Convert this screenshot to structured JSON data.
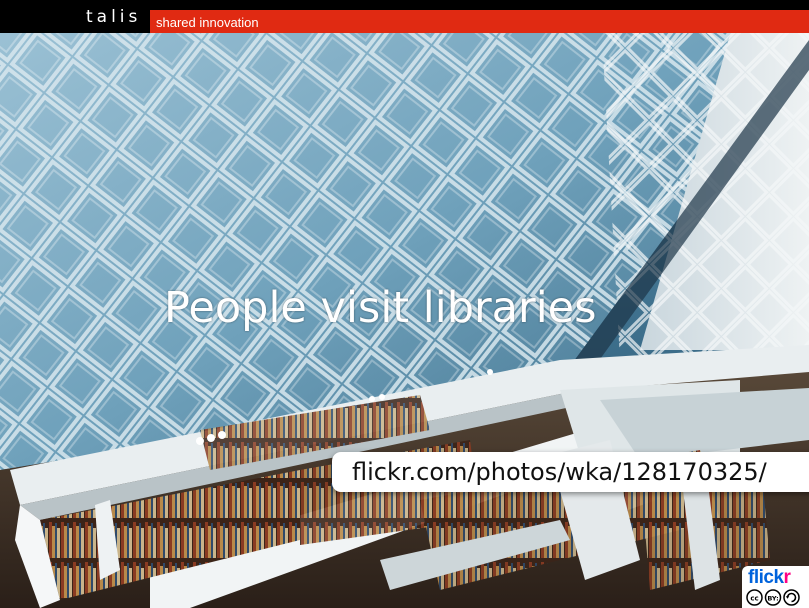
{
  "header": {
    "logo": "talis",
    "tagline": "shared innovation"
  },
  "slide": {
    "title": "People visit libraries",
    "attribution": "flickr.com/photos/wka/128170325/"
  },
  "badge": {
    "flickr_part1": "flick",
    "flickr_part2": "r",
    "license_icons": [
      "cc-icon",
      "by-icon",
      "sa-icon"
    ]
  },
  "colors": {
    "brand_red": "#e02a12",
    "flickr_blue": "#0063dc",
    "flickr_pink": "#ff0084"
  }
}
